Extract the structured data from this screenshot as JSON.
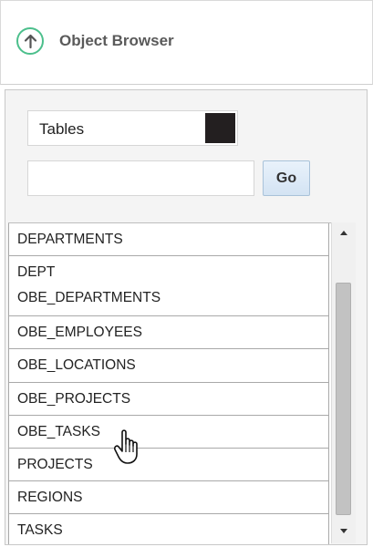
{
  "header": {
    "title": "Object Browser",
    "icon": "up-arrow-circle-icon",
    "accent": "#4cbf8c"
  },
  "filter": {
    "object_type": "Tables",
    "search_value": "",
    "go_label": "Go"
  },
  "objects": [
    "DEPARTMENTS",
    "DEPT",
    "OBE_DEPARTMENTS",
    "OBE_EMPLOYEES",
    "OBE_LOCATIONS",
    "OBE_PROJECTS",
    "OBE_TASKS",
    "PROJECTS",
    "REGIONS",
    "TASKS"
  ]
}
